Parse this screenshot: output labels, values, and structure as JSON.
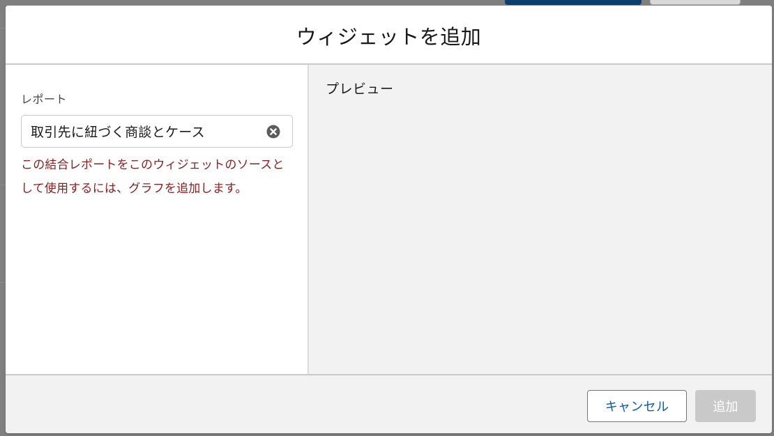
{
  "modal": {
    "title": "ウィジェットを追加"
  },
  "form": {
    "report_label": "レポート",
    "report_value": "取引先に紐づく商談とケース",
    "error_message": "この結合レポートをこのウィジェットのソースとして使用するには、グラフを追加します。"
  },
  "preview": {
    "label": "プレビュー"
  },
  "footer": {
    "cancel_label": "キャンセル",
    "add_label": "追加",
    "add_disabled": true
  },
  "icons": {
    "clear": "clear-circle-icon"
  },
  "colors": {
    "brand_link": "#0b5cab",
    "error_text": "#8c1d1d",
    "disabled_button": "#c9c9c9",
    "overlay": "#7f7f80",
    "background_primary_button": "#0b3f6e"
  }
}
